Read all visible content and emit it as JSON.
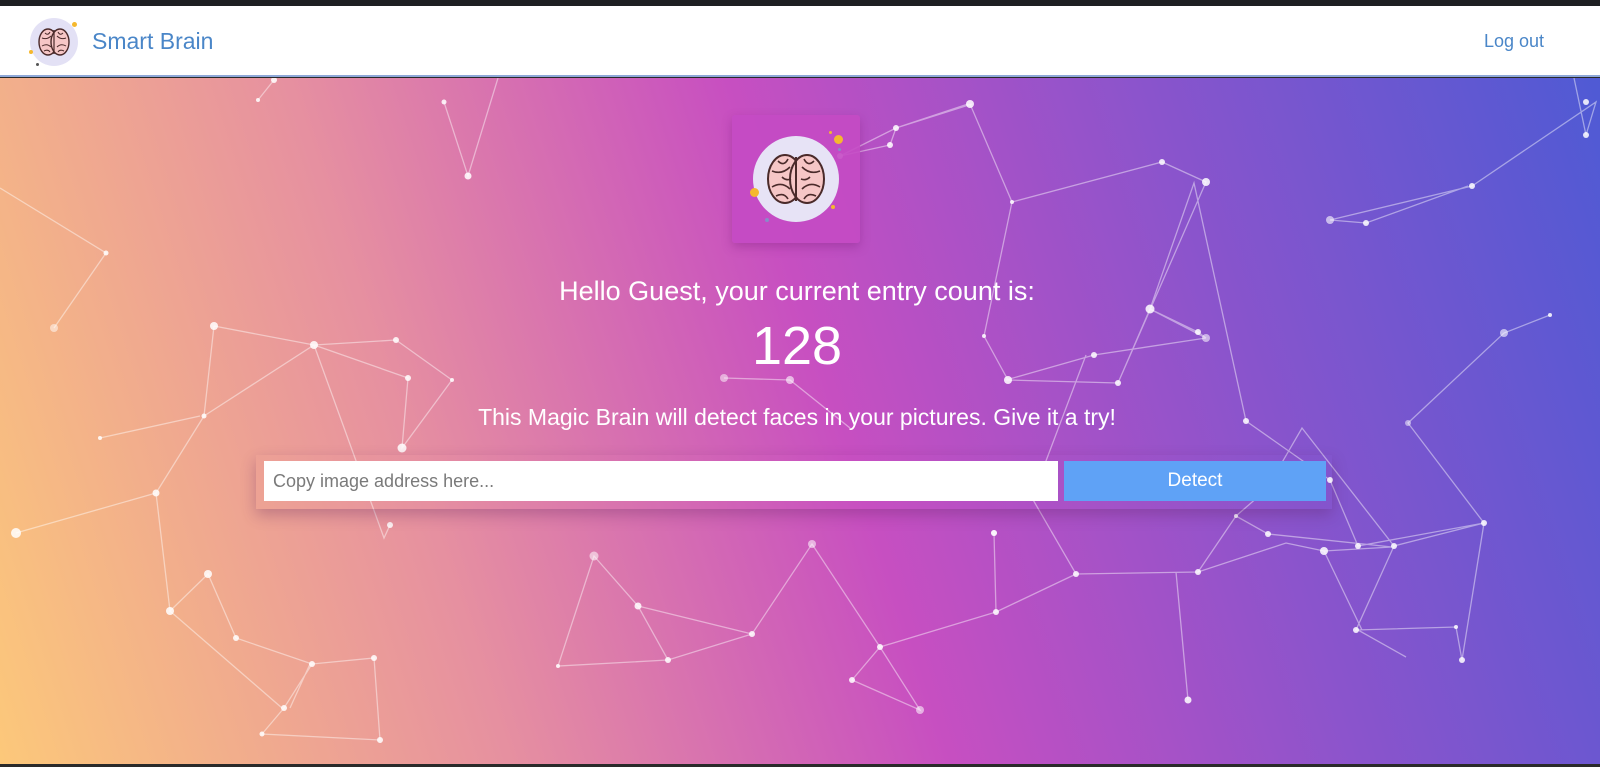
{
  "navbar": {
    "title": "Smart Brain",
    "logout_label": "Log out",
    "logo_icon": "brain-icon"
  },
  "main": {
    "logo_icon": "brain-icon",
    "greeting": "Hello Guest, your current entry count is:",
    "entry_count": "128",
    "tagline": "This Magic Brain will detect faces in your pictures. Give it a try!",
    "input_placeholder": "Copy image address here...",
    "input_value": "",
    "detect_label": "Detect"
  },
  "colors": {
    "brand_blue": "#4a86c8",
    "detect_button": "#5fa2f6",
    "gradient": [
      "#fcc87a",
      "#e690a0",
      "#c74fc1",
      "#8a54cc",
      "#4f5ad4"
    ]
  }
}
